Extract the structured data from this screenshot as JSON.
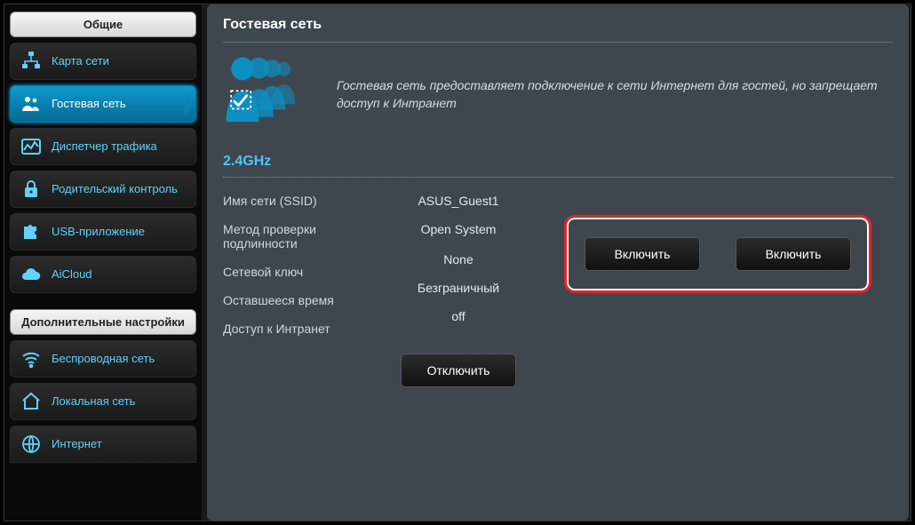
{
  "sidebar": {
    "group1_label": "Общие",
    "group2_label": "Дополнительные настройки",
    "items": [
      {
        "label": "Карта сети"
      },
      {
        "label": "Гостевая сеть"
      },
      {
        "label": "Диспетчер трафика"
      },
      {
        "label": "Родительский контроль"
      },
      {
        "label": "USB-приложение"
      },
      {
        "label": "AiCloud"
      }
    ],
    "items2": [
      {
        "label": "Беспроводная сеть"
      },
      {
        "label": "Локальная сеть"
      },
      {
        "label": "Интернет"
      }
    ]
  },
  "main": {
    "title": "Гостевая сеть",
    "intro": "Гостевая сеть предоставляет подключение к сети Интернет для гостей, но запрещает доступ к Интранет",
    "band": "2.4GHz",
    "fields": {
      "ssid_label": "Имя сети (SSID)",
      "ssid_value": "ASUS_Guest1",
      "auth_label": "Метод проверки подлинности",
      "auth_value": "Open System",
      "key_label": "Сетевой ключ",
      "key_value": "None",
      "time_label": "Оставшееся время",
      "time_value": "Безграничный",
      "intranet_label": "Доступ к Интранет",
      "intranet_value": "off"
    },
    "buttons": {
      "disable": "Отключить",
      "enable1": "Включить",
      "enable2": "Включить"
    }
  }
}
